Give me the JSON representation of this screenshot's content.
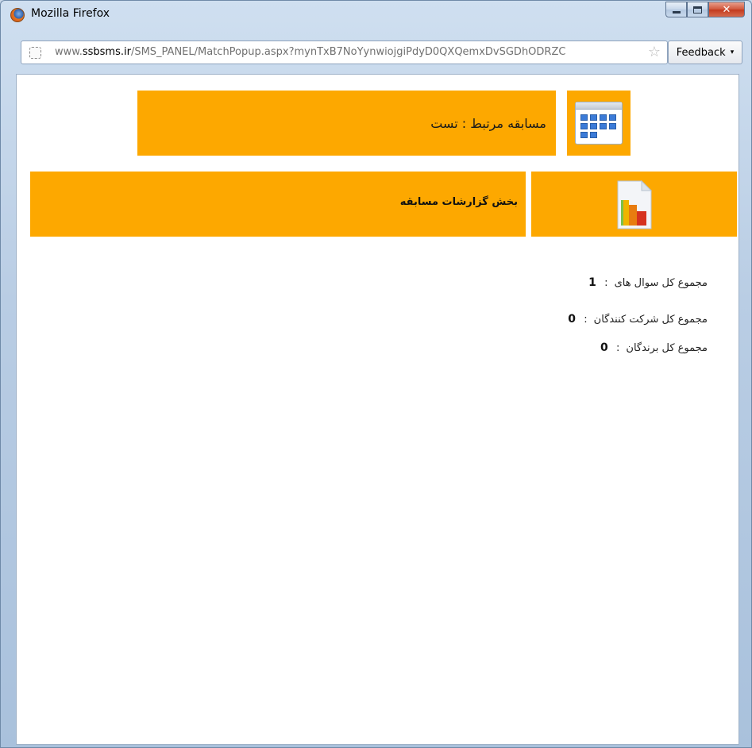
{
  "window": {
    "title": "Mozilla Firefox",
    "icon": "firefox-icon"
  },
  "addressbar": {
    "url_prefix": "www.",
    "url_host": "ssbsms.ir",
    "url_path": "/SMS_PANEL/MatchPopup.aspx?mynTxB7NoYynwiojgiPdyD0QXQemxDvSGDhODRZC",
    "feedback_label": "Feedback",
    "feedback_arrow": "▾"
  },
  "header": {
    "match_label": "مسابقه مرتبط : تست",
    "section_title": "بخش گزارشات مسابقه"
  },
  "stats": [
    {
      "label": "مجموع کل سوال های",
      "value": "1"
    },
    {
      "label": "مجموع کل شرکت کنندگان",
      "value": "0"
    },
    {
      "label": "مجموع کل برندگان",
      "value": "0"
    }
  ],
  "colors": {
    "accent": "#fda800"
  }
}
